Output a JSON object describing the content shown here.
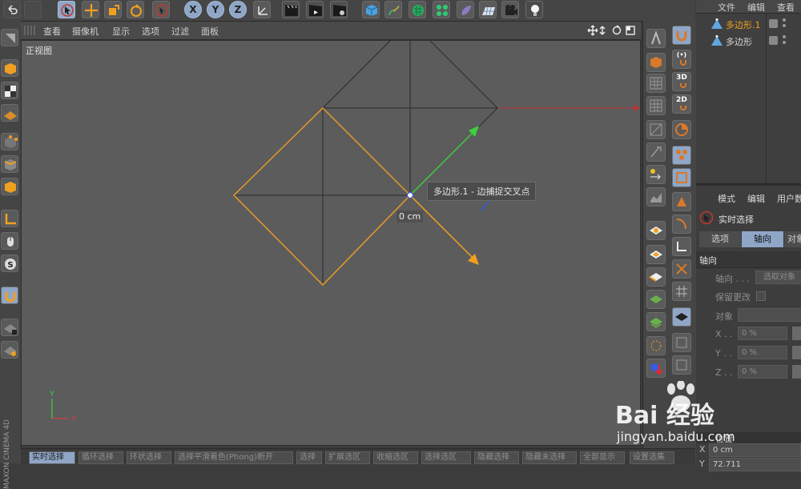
{
  "viewport": {
    "menu": [
      "查看",
      "摄像机",
      "显示",
      "选项",
      "过滤",
      "面板"
    ],
    "view_label": "正视图",
    "tooltip": "多边形.1 - 边捕捉交叉点",
    "distance_label": "0 cm"
  },
  "toolbar_icons": [
    "undo-icon",
    "redo-icon",
    "live-select-icon",
    "move-icon",
    "scale-icon",
    "rotate-icon",
    "recent-tools-icon",
    "x-axis-lock-icon",
    "y-axis-lock-icon",
    "z-axis-lock-icon",
    "world-coordinates-icon",
    "render-view-icon",
    "render-picture-viewer-icon",
    "render-settings-icon",
    "cube-icon",
    "pen-spline-icon",
    "subdivision-icon",
    "array-icon",
    "deformer-icon",
    "floor-icon",
    "camera-icon",
    "light-icon"
  ],
  "axis_buttons": {
    "x": "X",
    "y": "Y",
    "z": "Z"
  },
  "object_manager": {
    "menu": [
      "文件",
      "编辑",
      "查看"
    ],
    "objects": [
      {
        "name": "多边形.1",
        "selected": true
      },
      {
        "name": "多边形",
        "selected": false
      }
    ]
  },
  "attributes": {
    "menu": [
      "模式",
      "编辑",
      "用户数"
    ],
    "tool_name": "实时选择",
    "tabs": [
      "选项",
      "轴向",
      "对象"
    ],
    "active_tab": "轴向",
    "section": "轴向",
    "axis_label": "轴向 . . .",
    "axis_button": "选取对象",
    "keep_changes": "保留更改",
    "object_label": "对象",
    "coords": [
      {
        "label": "X . .",
        "value": "0 %"
      },
      {
        "label": "Y . .",
        "value": "0 %"
      },
      {
        "label": "Z . .",
        "value": "0 %"
      }
    ]
  },
  "coordinates": {
    "section": "位置",
    "x_label": "X",
    "x_value": "0 cm",
    "y_label": "Y",
    "y_value": "72.711"
  },
  "bottom_bar": [
    "实时选择",
    "循环选择",
    "环状选择",
    "选择平滑着色(Phong)断开",
    "选择",
    "扩展选区",
    "收缩选区",
    "选择选区",
    "隐藏选择",
    "隐藏未选择",
    "全部显示",
    "设置选集"
  ],
  "side_label": "MAXON CINEMA 4D",
  "watermark": {
    "brand": "Bai 经验",
    "url": "jingyan.baidu.com"
  },
  "colors": {
    "accent": "#8fa6c7",
    "selection_orange": "#f0a020",
    "x_axis": "#d23c3c",
    "y_axis": "#3cc83c",
    "z_axis": "#3c5adc"
  }
}
